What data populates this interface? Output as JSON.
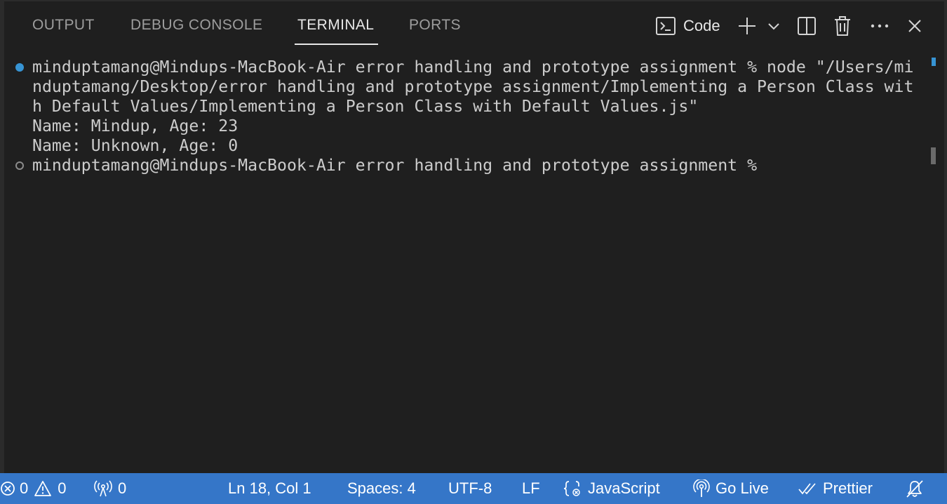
{
  "panel": {
    "tabs": [
      {
        "label": "OUTPUT",
        "active": false
      },
      {
        "label": "DEBUG CONSOLE",
        "active": false
      },
      {
        "label": "TERMINAL",
        "active": true
      },
      {
        "label": "PORTS",
        "active": false
      }
    ],
    "terminal_selector_label": "Code",
    "icons": [
      "terminal-icon",
      "plus-icon",
      "chevron-down-icon",
      "split-editor-icon",
      "trash-icon",
      "more-icon",
      "close-icon"
    ]
  },
  "terminal": {
    "lines": [
      "minduptamang@Mindups-MacBook-Air error handling and prototype assignment % node \"/Users/mi",
      "nduptamang/Desktop/error handling and prototype assignment/Implementing a Person Class wit",
      "h Default Values/Implementing a Person Class with Default Values.js\"",
      "Name: Mindup, Age: 23",
      "Name: Unknown, Age: 0",
      "minduptamang@Mindups-MacBook-Air error handling and prototype assignment % "
    ]
  },
  "status_bar": {
    "errors": "0",
    "warnings": "0",
    "ports": "0",
    "cursor_position": "Ln 18, Col 1",
    "indentation": "Spaces: 4",
    "encoding": "UTF-8",
    "line_ending": "LF",
    "language": "JavaScript",
    "go_live": "Go Live",
    "prettier": "Prettier",
    "background_color": "#3576c8"
  },
  "colors": {
    "background": "#1f1f1f",
    "text": "#cccccc",
    "tab_inactive": "#9d9d9d",
    "tab_active": "#e7e7e7",
    "success_decoration": "#3794d4"
  }
}
